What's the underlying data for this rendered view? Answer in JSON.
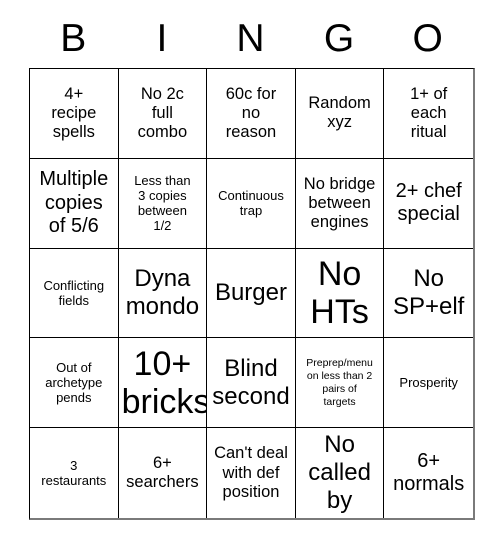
{
  "card": {
    "headers": [
      "B",
      "I",
      "N",
      "G",
      "O"
    ],
    "rows": [
      [
        {
          "text": "4+\nrecipe\nspells",
          "size": "md"
        },
        {
          "text": "No 2c\nfull\ncombo",
          "size": "md"
        },
        {
          "text": "60c for\nno\nreason",
          "size": "md"
        },
        {
          "text": "Random\nxyz",
          "size": "md"
        },
        {
          "text": "1+ of\neach\nritual",
          "size": "md"
        }
      ],
      [
        {
          "text": "Multiple\ncopies\nof 5/6",
          "size": "lg"
        },
        {
          "text": "Less than\n3 copies\nbetween\n1/2",
          "size": "sm"
        },
        {
          "text": "Continuous\ntrap",
          "size": "sm"
        },
        {
          "text": "No bridge\nbetween\nengines",
          "size": "md"
        },
        {
          "text": "2+ chef\nspecial",
          "size": "lg"
        }
      ],
      [
        {
          "text": "Conflicting\nfields",
          "size": "sm"
        },
        {
          "text": "Dyna\nmondo",
          "size": "xl"
        },
        {
          "text": "Burger",
          "size": "xl"
        },
        {
          "text": "No\nHTs",
          "size": "xxl"
        },
        {
          "text": "No\nSP+elf",
          "size": "xl"
        }
      ],
      [
        {
          "text": "Out of\narchetype\npends",
          "size": "sm"
        },
        {
          "text": "10+\nbricks",
          "size": "xxl"
        },
        {
          "text": "Blind\nsecond",
          "size": "xl"
        },
        {
          "text": "Preprep/menu\non less than 2\npairs of\ntargets",
          "size": "xs"
        },
        {
          "text": "Prosperity",
          "size": "sm"
        }
      ],
      [
        {
          "text": "3\nrestaurants",
          "size": "sm"
        },
        {
          "text": "6+\nsearchers",
          "size": "md"
        },
        {
          "text": "Can't deal\nwith def\nposition",
          "size": "md"
        },
        {
          "text": "No\ncalled\nby",
          "size": "xl"
        },
        {
          "text": "6+\nnormals",
          "size": "lg"
        }
      ]
    ]
  }
}
